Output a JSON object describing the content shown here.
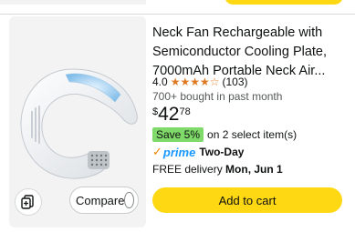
{
  "product": {
    "title_lines": [
      "Neck Fan Rechargeable with",
      "Semiconductor Cooling Plate,",
      "7000mAh Portable Neck Air..."
    ],
    "rating_value": "4.0",
    "stars": "★★★★☆",
    "review_count": "(103)",
    "bought_text": "700+ bought in past month",
    "price": {
      "currency": "$",
      "whole": "42",
      "fraction": "78"
    },
    "coupon": {
      "badge": "Save 5%",
      "text": "on 2 select item(s)"
    },
    "prime": {
      "check": "✓",
      "label": "prime",
      "speed": "Two-Day"
    },
    "delivery": {
      "prefix": "FREE delivery",
      "date": "Mon, Jun 1"
    },
    "compare_label": "Compare",
    "add_to_cart_label": "Add to cart",
    "image_alt": "White neck fan with blue cooling plate"
  },
  "colors": {
    "button_yellow": "#ffd814",
    "star_orange": "#de7921",
    "coupon_green": "#7fda69",
    "prime_blue": "#1a98ff"
  },
  "icons": [
    "compare-icon",
    "star-icon",
    "prime-check-icon",
    "compare-radio-icon"
  ]
}
